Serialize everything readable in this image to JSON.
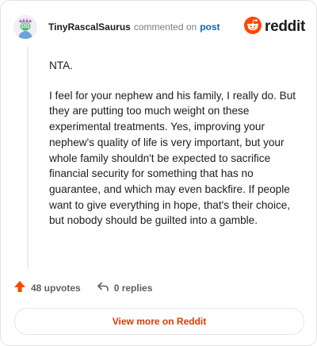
{
  "header": {
    "username": "TinyRascalSaurus",
    "action_text": "commented on",
    "post_link": "post",
    "brand": "reddit"
  },
  "comment": {
    "paragraphs": [
      "NTA.",
      "I feel for your nephew and his family, I really do. But they are putting too much weight on these experimental treatments. Yes, improving your nephew's quality of life is very important, but your whole family shouldn't be expected to sacrifice financial security for something that has no guarantee, and which may even backfire. If people want to give everything in hope, that's their choice, but nobody should be guilted into a gamble."
    ]
  },
  "actions": {
    "upvotes": "48 upvotes",
    "replies": "0 replies"
  },
  "footer": {
    "view_more": "View more on Reddit"
  },
  "colors": {
    "reddit_orange": "#ff4500",
    "link_blue": "#0a66c2",
    "view_more_text": "#d93a00"
  },
  "icons": [
    "avatar",
    "reddit-logo-icon",
    "upvote-arrow-icon",
    "reply-icon"
  ]
}
